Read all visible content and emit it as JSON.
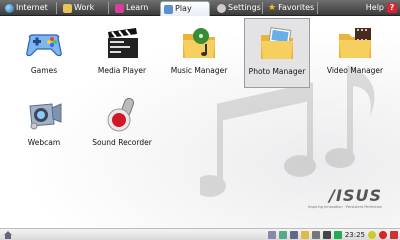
{
  "tabs": [
    {
      "label": "Internet"
    },
    {
      "label": "Work"
    },
    {
      "label": "Learn"
    },
    {
      "label": "Play"
    },
    {
      "label": "Settings"
    },
    {
      "label": "Favorites"
    }
  ],
  "help": {
    "label": "Help",
    "icon": "?"
  },
  "apps": [
    {
      "label": "Games"
    },
    {
      "label": "Media Player"
    },
    {
      "label": "Music Manager"
    },
    {
      "label": "Photo Manager"
    },
    {
      "label": "Video Manager"
    },
    {
      "label": "Webcam"
    },
    {
      "label": "Sound Recorder"
    }
  ],
  "brand": {
    "logo": "/ISUS",
    "tagline": "Inspiring Innovation · Persistent Perfection"
  },
  "taskbar": {
    "clock": "23:25"
  },
  "colors": {
    "accent": "#3b6fb6",
    "tabbar": "#4a4a4a",
    "selected": "#e3e3e6"
  }
}
